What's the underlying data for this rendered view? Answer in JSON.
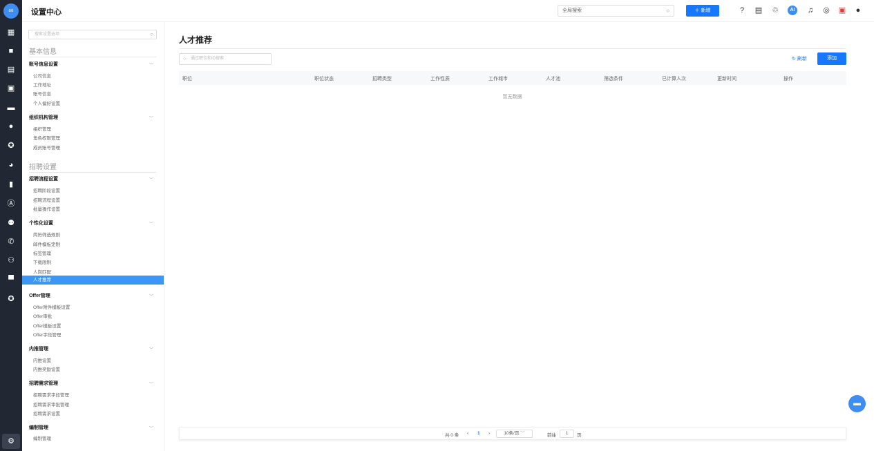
{
  "header": {
    "title": "设置中心",
    "search_placeholder": "全局搜索",
    "new_label": "＋ 新增"
  },
  "sidebar": {
    "search_placeholder": "搜索设置选项",
    "section_basic": "基本信息",
    "section_recruit": "招聘设置",
    "groups": [
      {
        "title": "账号信息设置",
        "items": [
          "公司信息",
          "工作地址",
          "账号信息",
          "个人偏好设置"
        ]
      },
      {
        "title": "组织机构管理",
        "items": [
          "组织管理",
          "角色权限管理",
          "成员账号管理"
        ]
      },
      {
        "title": "招聘流程设置",
        "items": [
          "招聘阶段设置",
          "招聘流程设置",
          "批量操作设置"
        ]
      },
      {
        "title": "个性化设置",
        "items": [
          "简历筛选规则",
          "邮件模板定制",
          "标签管理",
          "下载限制",
          "人岗匹配",
          "人才推荐"
        ]
      },
      {
        "title": "Offer管理",
        "items": [
          "Offer附件模板设置",
          "Offer审批",
          "Offer模板设置",
          "Offer字段管理"
        ]
      },
      {
        "title": "内推管理",
        "items": [
          "内推设置",
          "内推奖励设置"
        ]
      },
      {
        "title": "招聘需求管理",
        "items": [
          "招聘需求字段管理",
          "招聘需求审批管理",
          "招聘需求设置"
        ]
      },
      {
        "title": "编制管理",
        "items": [
          "编制管理"
        ]
      }
    ]
  },
  "main": {
    "title": "人才推荐",
    "search_placeholder": "通过职位和ID搜索",
    "refresh_label": "刷新",
    "add_label": "添加",
    "columns": [
      "职位",
      "职位状态",
      "招聘类型",
      "工作性质",
      "工作城市",
      "人才池",
      "筛选条件",
      "已计算人次",
      "更新时间",
      "操作"
    ],
    "empty_text": "暂无数据",
    "pager": {
      "total": "共 0 条",
      "prev": "‹",
      "page": "1",
      "next": "›",
      "page_size": "10条/页",
      "goto_label": "前往",
      "goto_value": "1",
      "page_unit": "页"
    }
  },
  "icons": {
    "rail": [
      "dashboard-icon",
      "briefcase-icon",
      "resume-icon",
      "calendar-icon",
      "idcard-icon",
      "wechat-icon",
      "star-icon",
      "pie-icon",
      "bar-chart-icon",
      "a-icon",
      "users-icon",
      "phone-icon",
      "user-add-icon",
      "message-icon",
      "circle-icon",
      "settings-icon"
    ],
    "header": [
      "help-icon",
      "doc-icon",
      "plugin-icon",
      "ai-icon",
      "bell-icon",
      "compass-icon",
      "gift-icon",
      "user-icon"
    ]
  },
  "colors": {
    "accent": "#1677ff",
    "rail": "#222833",
    "active": "#3d96f5"
  }
}
